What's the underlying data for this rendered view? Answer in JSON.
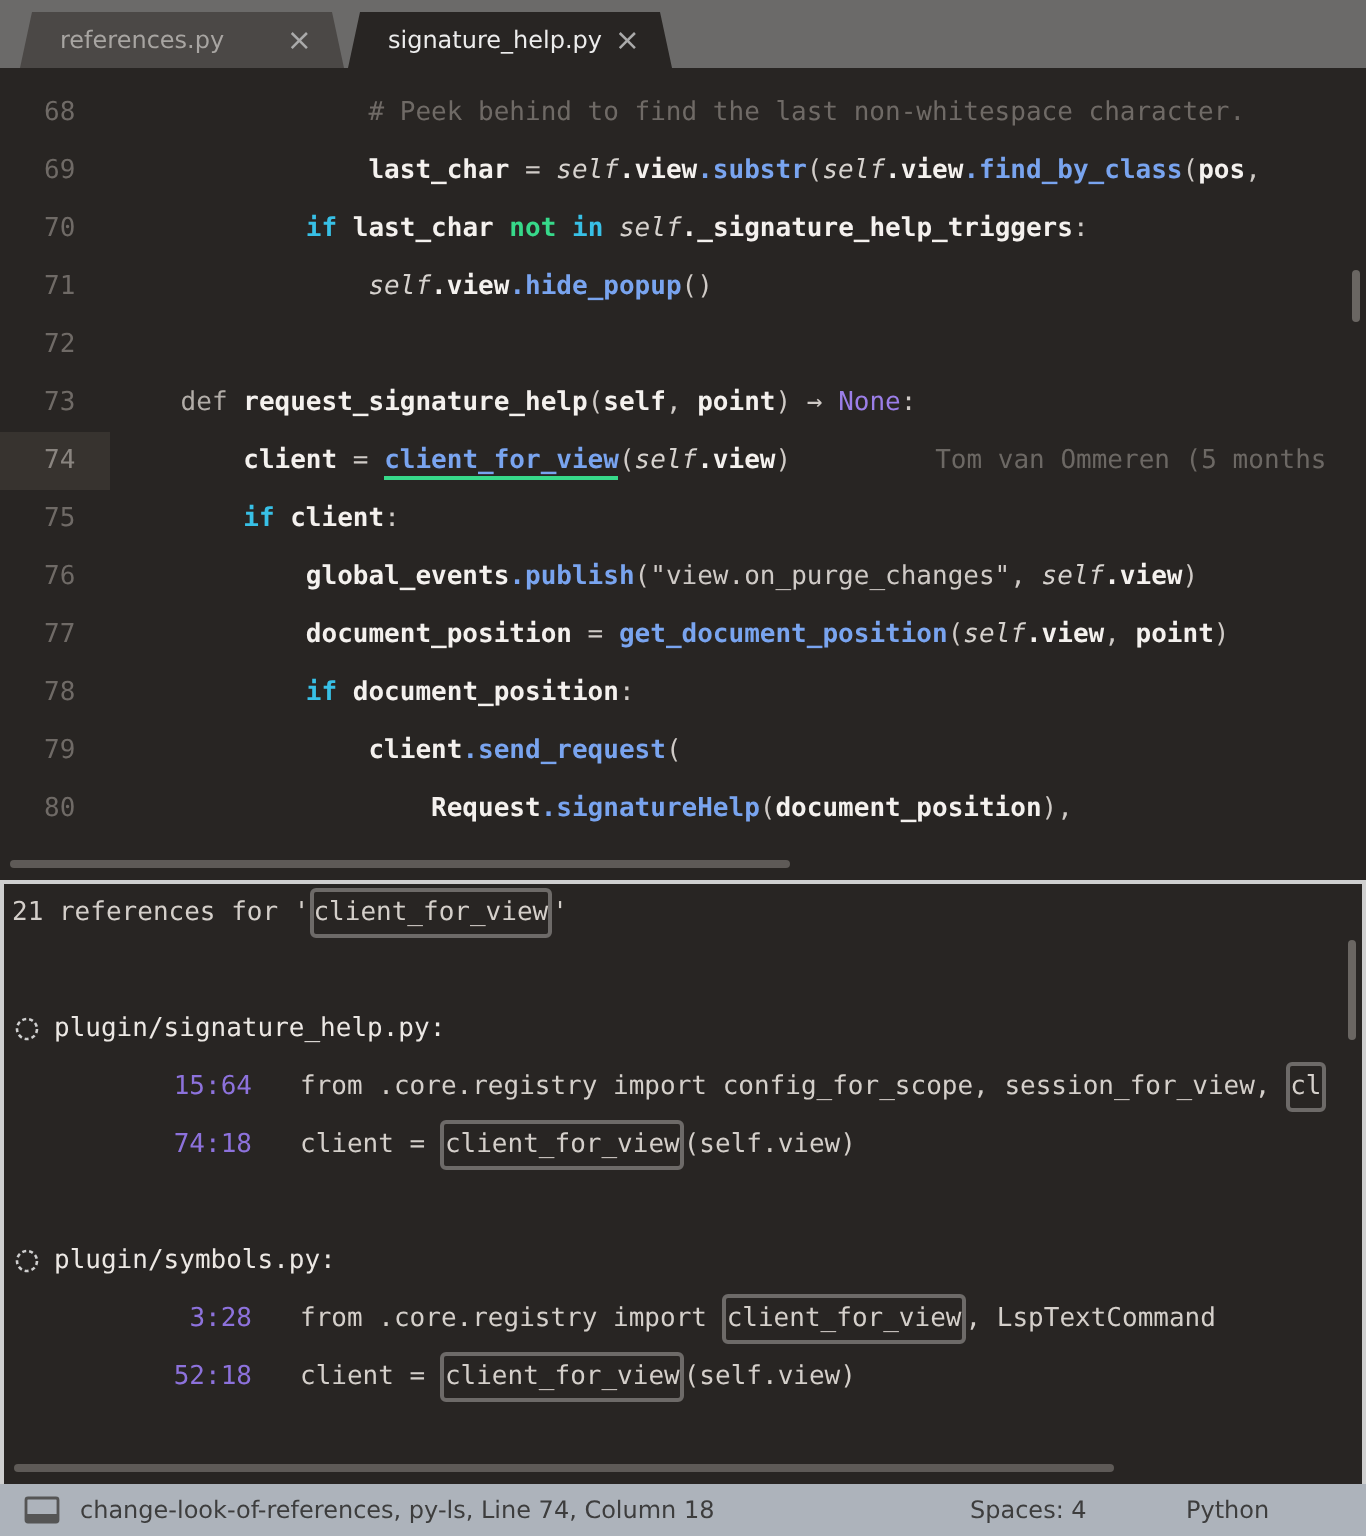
{
  "tabs": [
    {
      "label": "references.py",
      "selected": false,
      "close": "×"
    },
    {
      "label": "signature_help.py",
      "selected": true,
      "close": "×"
    }
  ],
  "editor": {
    "lines": [
      {
        "number": "68",
        "current": false,
        "tokens": [
          {
            "text": "                # Peek behind to find the last non-whitespace character.",
            "kind": "comment"
          }
        ]
      },
      {
        "number": "69",
        "current": false,
        "tokens": [
          {
            "text": "                last_char",
            "kind": "var"
          },
          {
            "text": " = ",
            "kind": "plain"
          },
          {
            "text": "self",
            "kind": "self"
          },
          {
            "text": ".view",
            "kind": "var"
          },
          {
            "text": ".substr",
            "kind": "fn"
          },
          {
            "text": "(",
            "kind": "plain"
          },
          {
            "text": "self",
            "kind": "self"
          },
          {
            "text": ".view",
            "kind": "var"
          },
          {
            "text": ".find_by_class",
            "kind": "fn"
          },
          {
            "text": "(",
            "kind": "plain"
          },
          {
            "text": "pos",
            "kind": "var"
          },
          {
            "text": ",",
            "kind": "plain"
          }
        ]
      },
      {
        "number": "70",
        "current": false,
        "tokens": [
          {
            "text": "            if",
            "kind": "kw"
          },
          {
            "text": " last_char",
            "kind": "var"
          },
          {
            "text": " not",
            "kind": "opkw"
          },
          {
            "text": " in",
            "kind": "kw"
          },
          {
            "text": " self",
            "kind": "self"
          },
          {
            "text": "._signature_help_triggers",
            "kind": "var"
          },
          {
            "text": ":",
            "kind": "plain"
          }
        ]
      },
      {
        "number": "71",
        "current": false,
        "tokens": [
          {
            "text": "                self",
            "kind": "self"
          },
          {
            "text": ".view",
            "kind": "var"
          },
          {
            "text": ".hide_popup",
            "kind": "fn"
          },
          {
            "text": "()",
            "kind": "plain"
          }
        ]
      },
      {
        "number": "72",
        "current": false
      },
      {
        "number": "73",
        "current": false,
        "tokens": [
          {
            "text": "    def",
            "kind": "def"
          },
          {
            "text": " request_signature_help",
            "kind": "var"
          },
          {
            "text": "(",
            "kind": "plain"
          },
          {
            "text": "self",
            "kind": "var"
          },
          {
            "text": ", ",
            "kind": "plain"
          },
          {
            "text": "point",
            "kind": "var"
          },
          {
            "text": ") → ",
            "kind": "plain"
          },
          {
            "text": "None",
            "kind": "const"
          },
          {
            "text": ":",
            "kind": "plain"
          }
        ]
      },
      {
        "number": "74",
        "current": true,
        "tokens": [
          {
            "text": "        client",
            "kind": "var"
          },
          {
            "text": " = ",
            "kind": "plain"
          },
          {
            "text": "client_for_view",
            "kind": "ref"
          },
          {
            "text": "(",
            "kind": "plain"
          },
          {
            "text": "self",
            "kind": "self"
          },
          {
            "text": ".view",
            "kind": "var"
          },
          {
            "text": ")",
            "kind": "plain"
          }
        ],
        "blame": "Tom van Ommeren (5 months"
      },
      {
        "number": "75",
        "current": false,
        "tokens": [
          {
            "text": "        if",
            "kind": "kw"
          },
          {
            "text": " client",
            "kind": "var"
          },
          {
            "text": ":",
            "kind": "plain"
          }
        ]
      },
      {
        "number": "76",
        "current": false,
        "tokens": [
          {
            "text": "            global_events",
            "kind": "var"
          },
          {
            "text": ".publish",
            "kind": "fn"
          },
          {
            "text": "(\"view.on_purge_changes\", ",
            "kind": "plain"
          },
          {
            "text": "self",
            "kind": "self"
          },
          {
            "text": ".view",
            "kind": "var"
          },
          {
            "text": ")",
            "kind": "plain"
          }
        ]
      },
      {
        "number": "77",
        "current": false,
        "tokens": [
          {
            "text": "            document_position",
            "kind": "var"
          },
          {
            "text": " = ",
            "kind": "plain"
          },
          {
            "text": "get_document_position",
            "kind": "fn"
          },
          {
            "text": "(",
            "kind": "plain"
          },
          {
            "text": "self",
            "kind": "self"
          },
          {
            "text": ".view",
            "kind": "var"
          },
          {
            "text": ", ",
            "kind": "plain"
          },
          {
            "text": "point",
            "kind": "var"
          },
          {
            "text": ")",
            "kind": "plain"
          }
        ]
      },
      {
        "number": "78",
        "current": false,
        "tokens": [
          {
            "text": "            if",
            "kind": "kw"
          },
          {
            "text": " document_position",
            "kind": "var"
          },
          {
            "text": ":",
            "kind": "plain"
          }
        ]
      },
      {
        "number": "79",
        "current": false,
        "tokens": [
          {
            "text": "                client",
            "kind": "var"
          },
          {
            "text": ".send_request",
            "kind": "fn"
          },
          {
            "text": "(",
            "kind": "plain"
          }
        ]
      },
      {
        "number": "80",
        "current": false,
        "tokens": [
          {
            "text": "                    Request",
            "kind": "var"
          },
          {
            "text": ".signatureHelp",
            "kind": "fn"
          },
          {
            "text": "(",
            "kind": "plain"
          },
          {
            "text": "document_position",
            "kind": "var"
          },
          {
            "text": "),",
            "kind": "plain"
          }
        ]
      }
    ]
  },
  "references": {
    "header": [
      {
        "text": "21 references for '",
        "boxed": false
      },
      {
        "text": "client_for_view",
        "boxed": true
      },
      {
        "text": "'",
        "boxed": false
      }
    ],
    "files": [
      {
        "path": "plugin/signature_help.py:",
        "refs": [
          {
            "position": "15:64",
            "parts": [
              {
                "text": "from .core.registry import config_for_scope, session_for_view, ",
                "boxed": false
              },
              {
                "text": "cl",
                "boxed": true
              }
            ]
          },
          {
            "position": "74:18",
            "parts": [
              {
                "text": "client = ",
                "boxed": false
              },
              {
                "text": "client_for_view",
                "boxed": true
              },
              {
                "text": "(self.view)",
                "boxed": false
              }
            ]
          }
        ]
      },
      {
        "path": "plugin/symbols.py:",
        "refs": [
          {
            "position": "3:28",
            "parts": [
              {
                "text": "from .core.registry import ",
                "boxed": false
              },
              {
                "text": "client_for_view",
                "boxed": true
              },
              {
                "text": ", LspTextCommand",
                "boxed": false
              }
            ]
          },
          {
            "position": "52:18",
            "parts": [
              {
                "text": "client = ",
                "boxed": false
              },
              {
                "text": "client_for_view",
                "boxed": true
              },
              {
                "text": "(self.view)",
                "boxed": false
              }
            ]
          }
        ]
      }
    ]
  },
  "status_bar": {
    "text": "change-look-of-references, py-ls, Line 74, Column 18",
    "indentation": "Spaces: 4",
    "syntax": "Python"
  }
}
